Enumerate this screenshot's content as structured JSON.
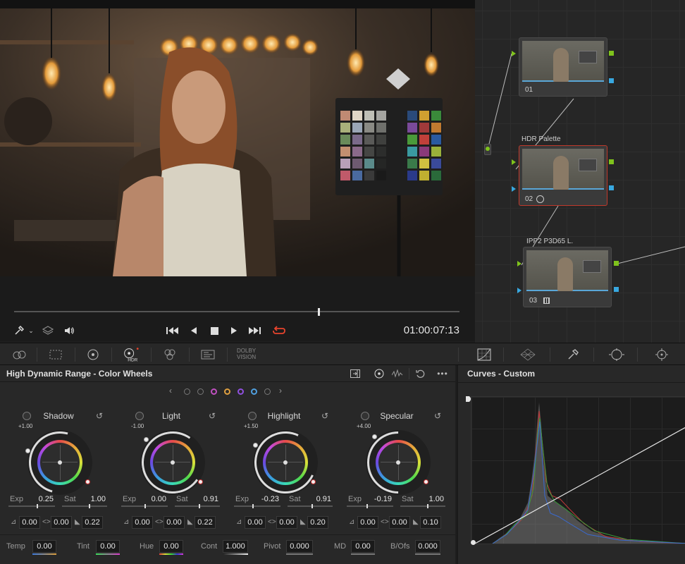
{
  "viewer": {
    "timecode": "01:00:07:13"
  },
  "transport_icons": [
    "eyedropper-icon",
    "layers-icon",
    "speaker-icon",
    "skip-back-icon",
    "play-reverse-icon",
    "stop-icon",
    "play-icon",
    "skip-forward-icon",
    "loop-icon"
  ],
  "node_graph": {
    "nodes": [
      {
        "label": "01",
        "name": ""
      },
      {
        "label": "02",
        "name": "HDR Palette"
      },
      {
        "label": "03",
        "name": "IPP2 P3D65 L."
      }
    ]
  },
  "palette_bar": {
    "dolby_label_1": "DOLBY",
    "dolby_label_2": "VISION",
    "icons": [
      "camera-raw-icon",
      "color-match-icon",
      "color-wheels-icon",
      "hdr-icon",
      "rgb-mixer-icon",
      "motion-effects-icon",
      "dolby-vision-icon",
      "curves-icon",
      "color-warper-icon",
      "qualifier-icon",
      "window-icon",
      "tracker-icon"
    ]
  },
  "color_wheels": {
    "title": "High Dynamic Range - Color Wheels",
    "wheels": [
      {
        "name": "Shadow",
        "value": "+1.00",
        "exp": "0.25",
        "sat": "1.00",
        "x": "0.00",
        "y": "0.00",
        "z": "0.22"
      },
      {
        "name": "Light",
        "value": "-1.00",
        "exp": "0.00",
        "sat": "0.91",
        "x": "0.00",
        "y": "0.00",
        "z": "0.22"
      },
      {
        "name": "Highlight",
        "value": "+1.50",
        "exp": "-0.23",
        "sat": "0.91",
        "x": "0.00",
        "y": "0.00",
        "z": "0.20"
      },
      {
        "name": "Specular",
        "value": "+4.00",
        "exp": "-0.19",
        "sat": "1.00",
        "x": "0.00",
        "y": "0.00",
        "z": "0.10"
      }
    ],
    "exp_label": "Exp",
    "sat_label": "Sat",
    "bottom": [
      {
        "label": "Temp",
        "value": "0.00"
      },
      {
        "label": "Tint",
        "value": "0.00"
      },
      {
        "label": "Hue",
        "value": "0.00"
      },
      {
        "label": "Cont",
        "value": "1.000"
      },
      {
        "label": "Pivot",
        "value": "0.000"
      },
      {
        "label": "MD",
        "value": "0.00"
      },
      {
        "label": "B/Ofs",
        "value": "0.000"
      }
    ]
  },
  "curves": {
    "title": "Curves - Custom"
  },
  "colors": {
    "accent_blue": "#38a8e0",
    "accent_green": "#7fc31c",
    "selected_red": "#c0392b"
  }
}
